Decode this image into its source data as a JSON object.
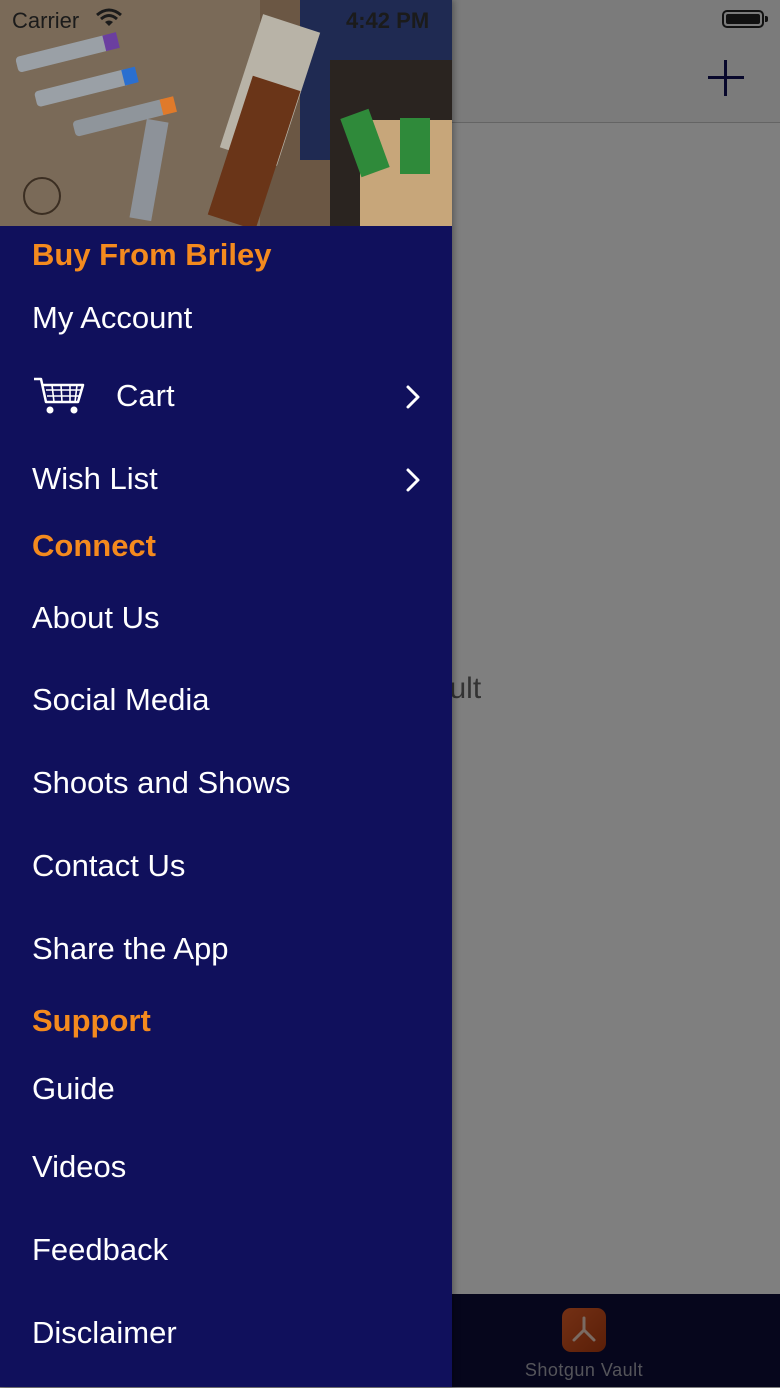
{
  "status_bar": {
    "carrier": "Carrier",
    "time": "4:42 PM"
  },
  "background": {
    "empty_title": "ult",
    "empty_subtitle": "ur Vault",
    "tab_label": "Shotgun Vault"
  },
  "drawer": {
    "sections": [
      {
        "header": "Buy From Briley",
        "items": [
          {
            "label": "My Account"
          },
          {
            "label": "Cart"
          },
          {
            "label": "Wish List"
          }
        ]
      },
      {
        "header": "Connect",
        "items": [
          {
            "label": "About Us"
          },
          {
            "label": "Social Media"
          },
          {
            "label": "Shoots and Shows"
          },
          {
            "label": "Contact Us"
          },
          {
            "label": "Share the App"
          }
        ]
      },
      {
        "header": "Support",
        "items": [
          {
            "label": "Guide"
          },
          {
            "label": "Videos"
          },
          {
            "label": "Feedback"
          },
          {
            "label": "Disclaimer"
          }
        ]
      }
    ]
  },
  "colors": {
    "drawer_bg": "#10105c",
    "section_header": "#f48a1e",
    "item_text": "#ffffff",
    "tabbar_bg": "#0d0d38"
  }
}
